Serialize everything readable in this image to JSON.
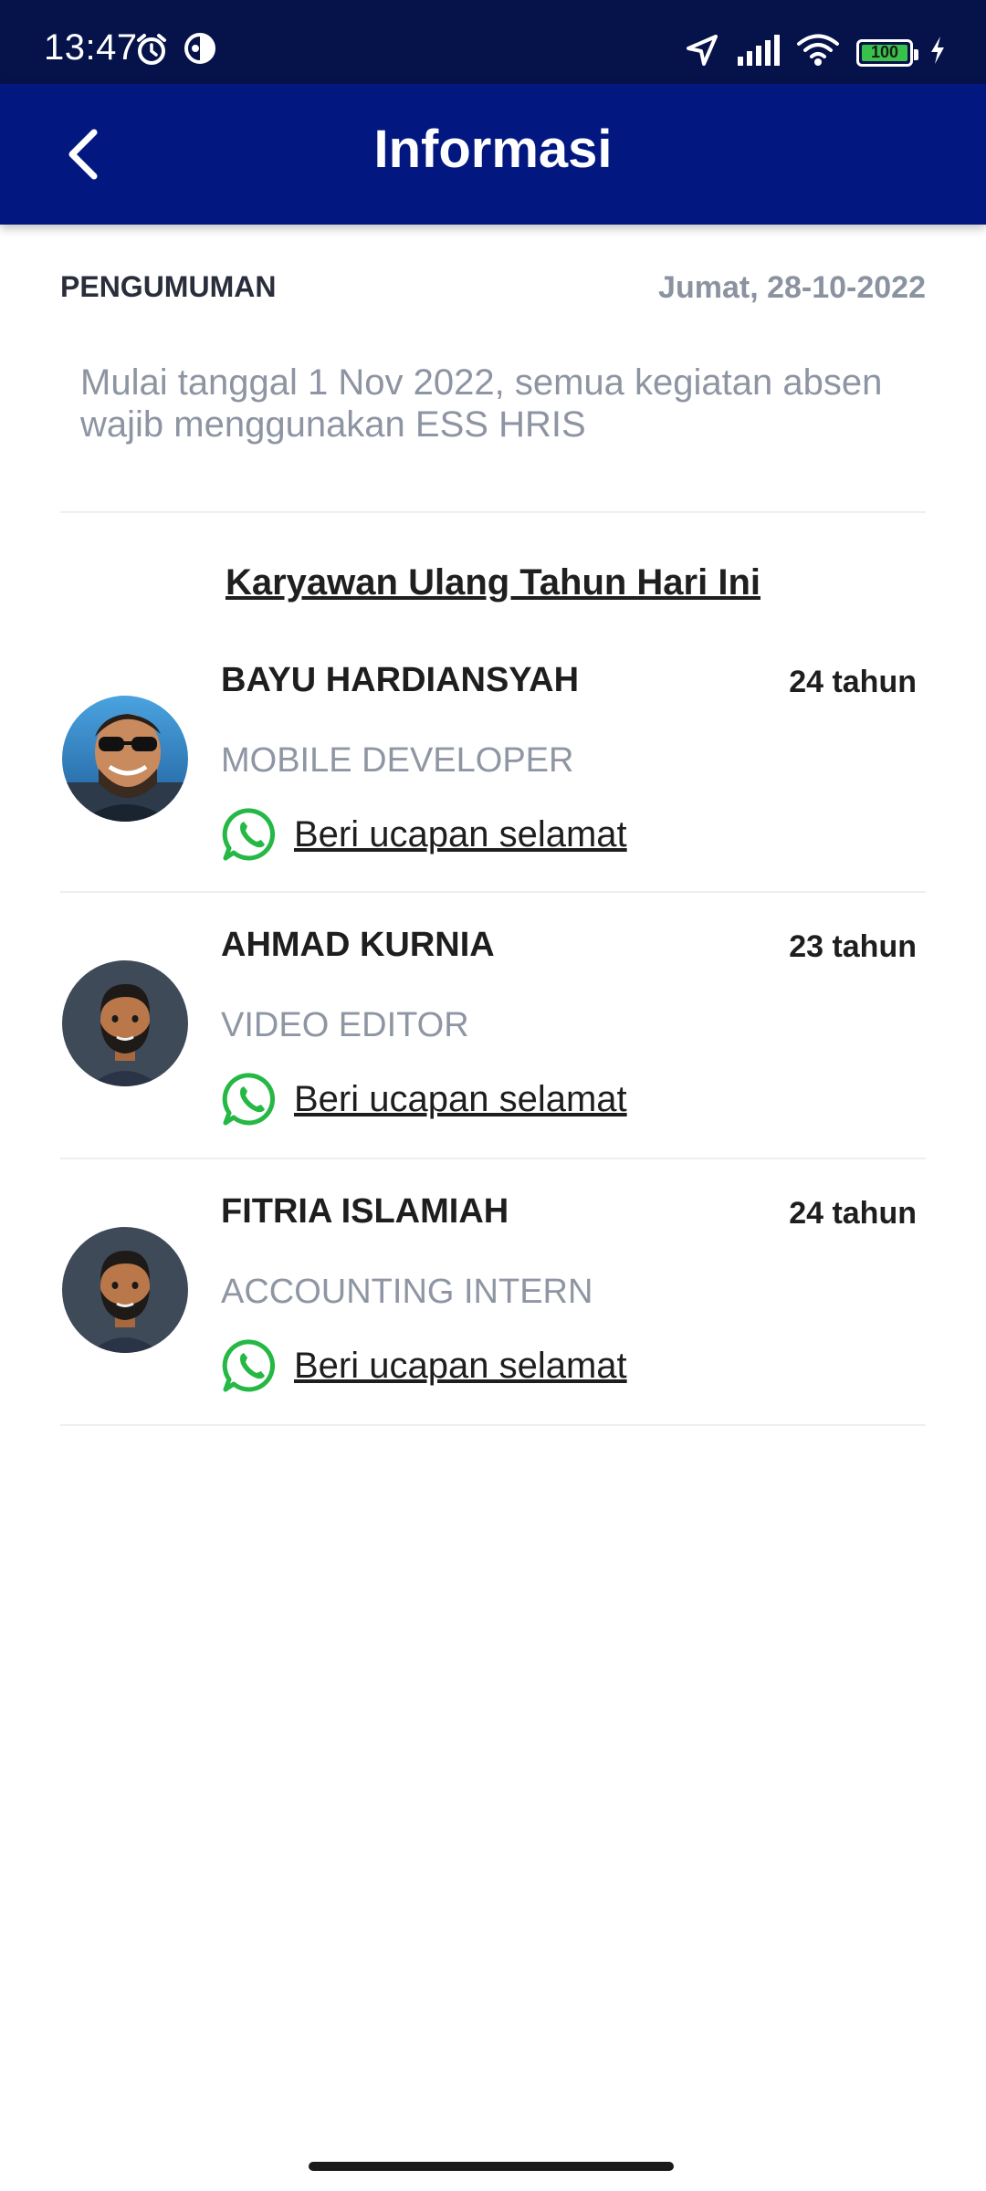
{
  "status_bar": {
    "time": "13:47",
    "battery": "100",
    "icons": [
      "alarm-icon",
      "data-saver-icon",
      "location-arrow-icon",
      "signal-icon",
      "wifi-icon",
      "battery-icon",
      "charging-icon"
    ]
  },
  "app_bar": {
    "title": "Informasi",
    "back_icon": "chevron-left-icon"
  },
  "announcement": {
    "label": "PENGUMUMAN",
    "date": "Jumat, 28-10-2022",
    "text": "Mulai tanggal 1 Nov 2022, semua kegiatan absen wajib menggunakan ESS HRIS"
  },
  "birthdays": {
    "title": "Karyawan Ulang Tahun Hari Ini",
    "items": [
      {
        "name": "BAYU HARDIANSYAH",
        "role": "MOBILE DEVELOPER",
        "age": "24 tahun",
        "action": "Beri ucapan selamat",
        "avatar": "photo"
      },
      {
        "name": "AHMAD KURNIA",
        "role": "VIDEO EDITOR",
        "age": "23 tahun",
        "action": "Beri ucapan selamat",
        "avatar": "default-avatar"
      },
      {
        "name": "FITRIA ISLAMIAH",
        "role": "ACCOUNTING INTERN",
        "age": "24 tahun",
        "action": "Beri ucapan selamat",
        "avatar": "default-avatar"
      }
    ]
  },
  "colors": {
    "status_bar_bg": "#06124a",
    "app_bar_bg": "#021880",
    "whatsapp_green": "#25b845",
    "muted_text": "#8d94a2"
  }
}
